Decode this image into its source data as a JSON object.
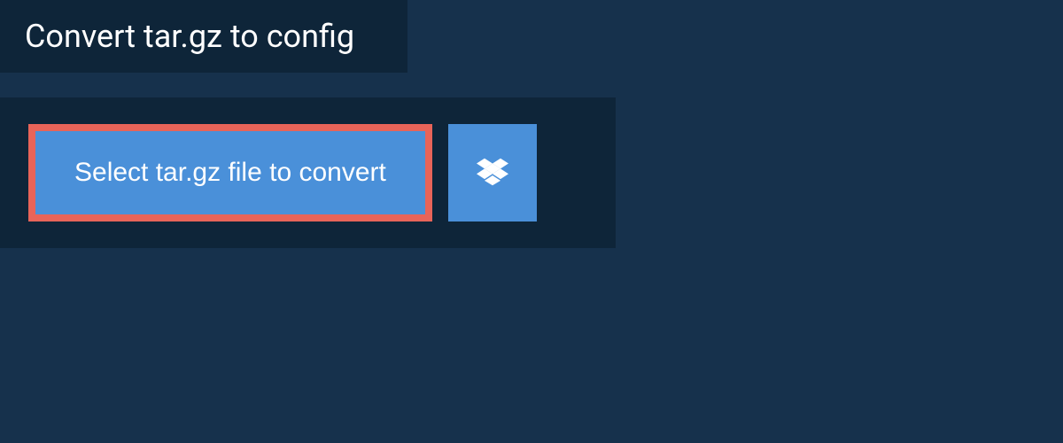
{
  "header": {
    "title": "Convert tar.gz to config"
  },
  "actions": {
    "select_file_label": "Select tar.gz file to convert",
    "dropbox_icon": "dropbox"
  },
  "colors": {
    "bg_outer": "#16314c",
    "bg_panel": "#0e2539",
    "button_fill": "#4a90d9",
    "button_border": "#e86459",
    "text": "#ffffff"
  }
}
